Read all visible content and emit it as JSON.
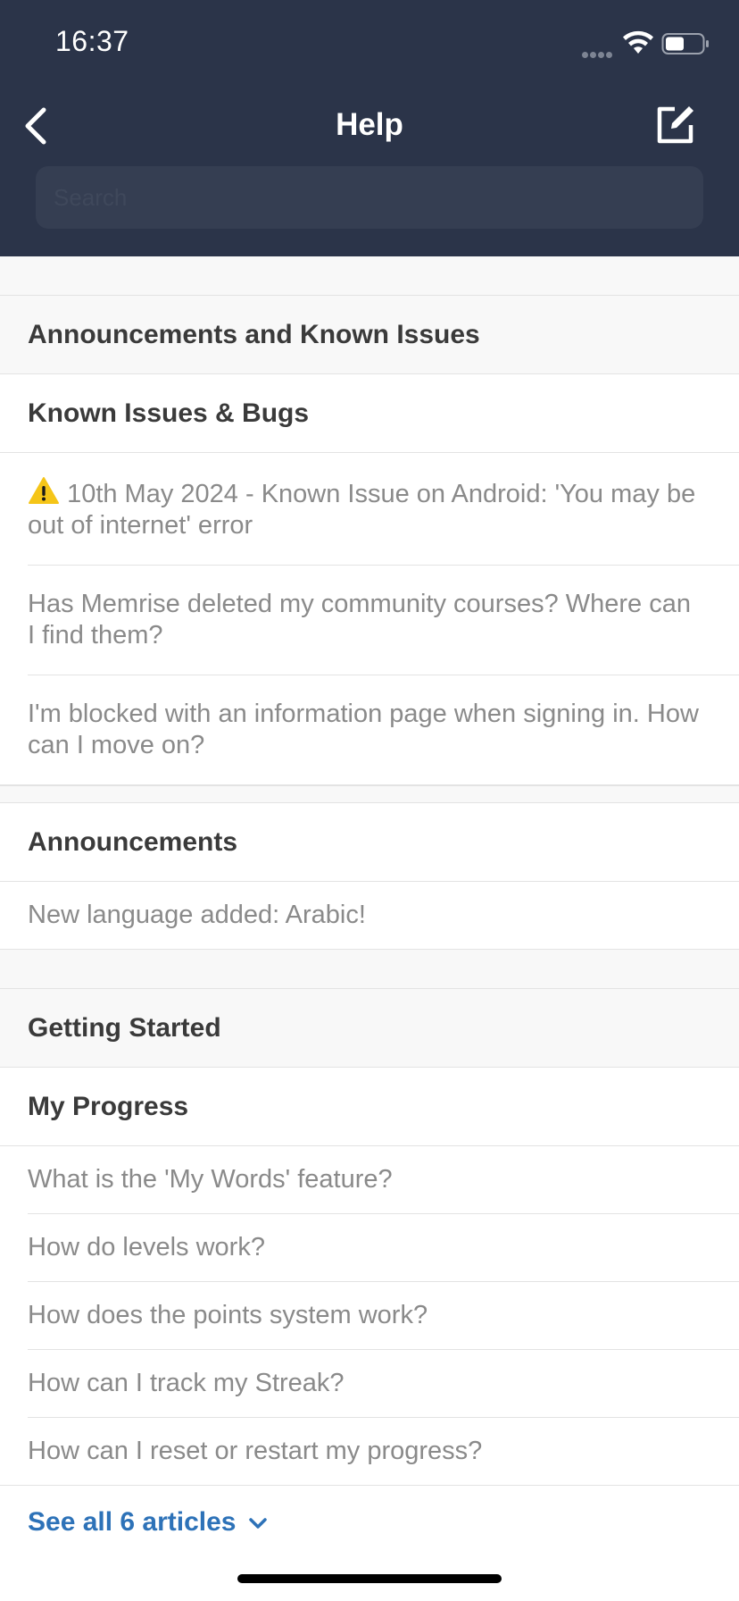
{
  "status_bar": {
    "time": "16:37"
  },
  "header": {
    "title": "Help"
  },
  "search": {
    "placeholder": "Search"
  },
  "categories": [
    {
      "title": "Announcements and Known Issues",
      "sections": [
        {
          "title": "Known Issues & Bugs",
          "articles": [
            "10th May 2024 - Known Issue on Android: 'You may be out of internet' error",
            "Has Memrise deleted my community courses? Where can I find them?",
            "I'm blocked with an information page when signing in. How can I move on?"
          ]
        },
        {
          "title": "Announcements",
          "articles": [
            "New language added: Arabic!"
          ]
        }
      ]
    },
    {
      "title": "Getting Started",
      "sections": [
        {
          "title": "My Progress",
          "articles": [
            "What is the 'My Words' feature?",
            "How do levels work?",
            "How does the points system work?",
            "How can I track my Streak?",
            "How can I reset or restart my progress?"
          ],
          "see_all": "See all 6 articles"
        }
      ]
    }
  ],
  "colors": {
    "header_bg": "#2b3449",
    "link": "#2d72b8",
    "warning": "#f5c518"
  },
  "icons": [
    "back-chevron-icon",
    "compose-icon",
    "wifi-icon",
    "battery-icon",
    "warning-icon",
    "chevron-down-icon"
  ]
}
